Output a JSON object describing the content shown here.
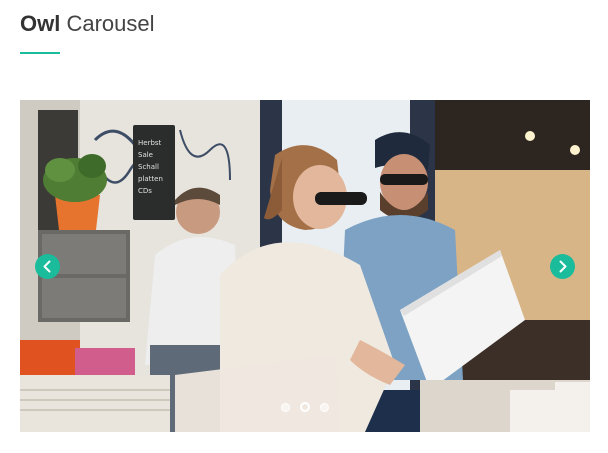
{
  "header": {
    "title_bold": "Owl",
    "title_light": "Carousel"
  },
  "carousel": {
    "prev_icon": "chevron-left-icon",
    "next_icon": "chevron-right-icon",
    "accent_color": "#1abc9c",
    "slide_count": 3,
    "active_index": 1,
    "slide_image": "photo-couple-browsing-records-at-flea-market",
    "store_sign": "Sale"
  },
  "colors": {
    "accent": "#1abc9c",
    "text": "#333333"
  }
}
